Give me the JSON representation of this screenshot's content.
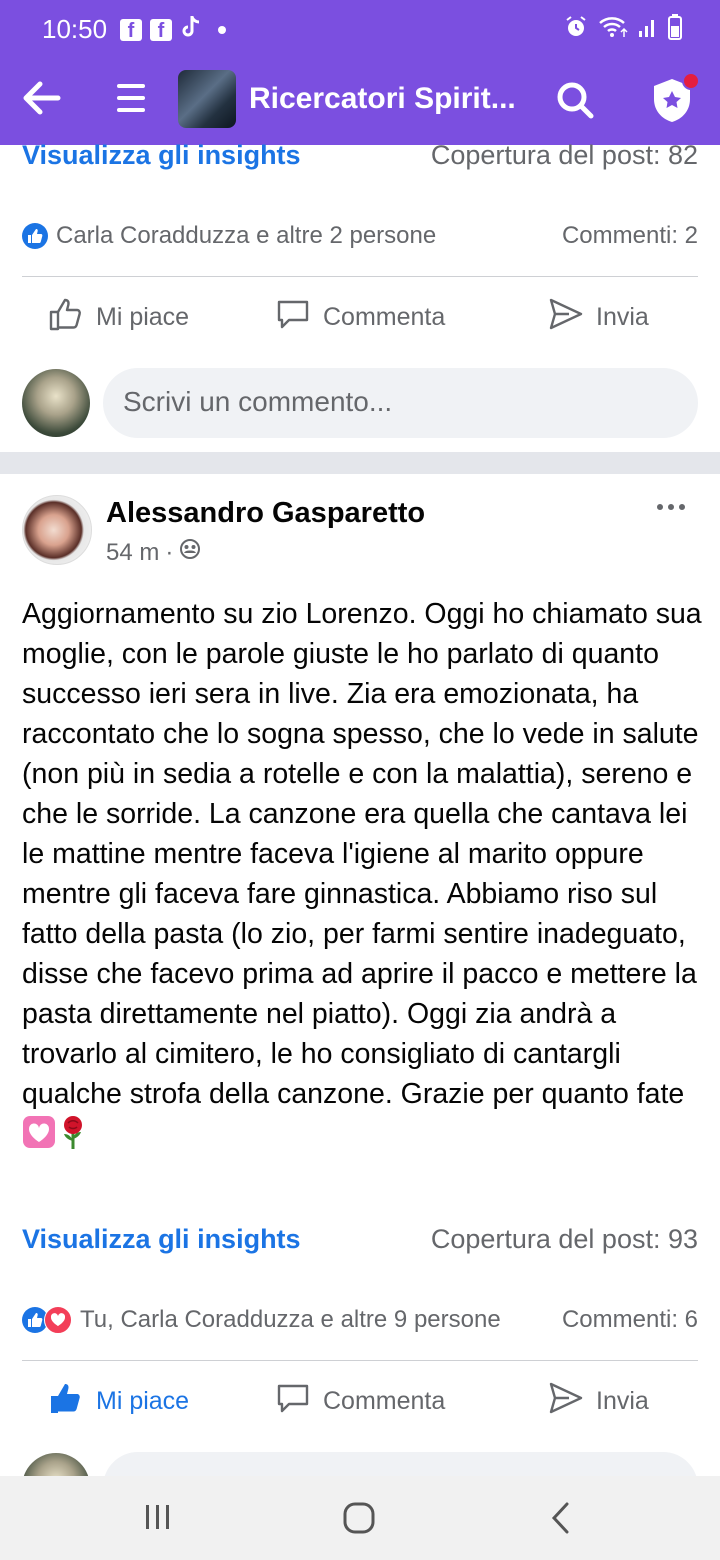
{
  "status": {
    "time": "10:50",
    "notif_icons": [
      "facebook-icon",
      "facebook-icon",
      "tiktok-icon",
      "dot-icon"
    ],
    "sys_icons": [
      "alarm-icon",
      "wifi-icon",
      "signal-icon",
      "battery-icon"
    ]
  },
  "toolbar": {
    "title": "Ricercatori Spirit..."
  },
  "post1": {
    "insights": "Visualizza gli insights",
    "reach": "Copertura del post: 82",
    "reactions": "Carla Coradduzza e altre 2 persone",
    "comments": "Commenti: 2"
  },
  "actions": {
    "like": "Mi piace",
    "comment": "Commenta",
    "send": "Invia"
  },
  "comment_box": {
    "placeholder": "Scrivi un commento..."
  },
  "post2": {
    "author": "Alessandro Gasparetto",
    "time": "54 m",
    "sep": "·",
    "text": "Aggiornamento su zio Lorenzo. Oggi ho chiamato sua moglie, con le parole giuste le ho parlato di quanto successo ieri sera in live. Zia era emozionata, ha raccontato che lo sogna spesso, che lo vede in salute (non più in sedia a rotelle e con la malattia), sereno e che le sorride. La canzone era quella che cantava lei le mattine mentre faceva l'igiene al marito oppure mentre gli faceva fare ginnastica. Abbiamo riso sul fatto della pasta (lo zio, per farmi sentire inadeguato, disse che facevo prima ad aprire il pacco e mettere la pasta direttamente nel piatto). Oggi zia andrà a trovarlo al cimitero, le ho consigliato di cantargli qualche strofa della canzone. Grazie per quanto fate",
    "emojis": [
      "💟",
      "🌹"
    ],
    "insights": "Visualizza gli insights",
    "reach": "Copertura del post: 93",
    "reactions": "Tu, Carla Coradduzza e altre 9 persone",
    "comments": "Commenti: 6"
  },
  "colors": {
    "header": "#7b4fe0",
    "link": "#1b74e4",
    "muted": "#65676b"
  }
}
